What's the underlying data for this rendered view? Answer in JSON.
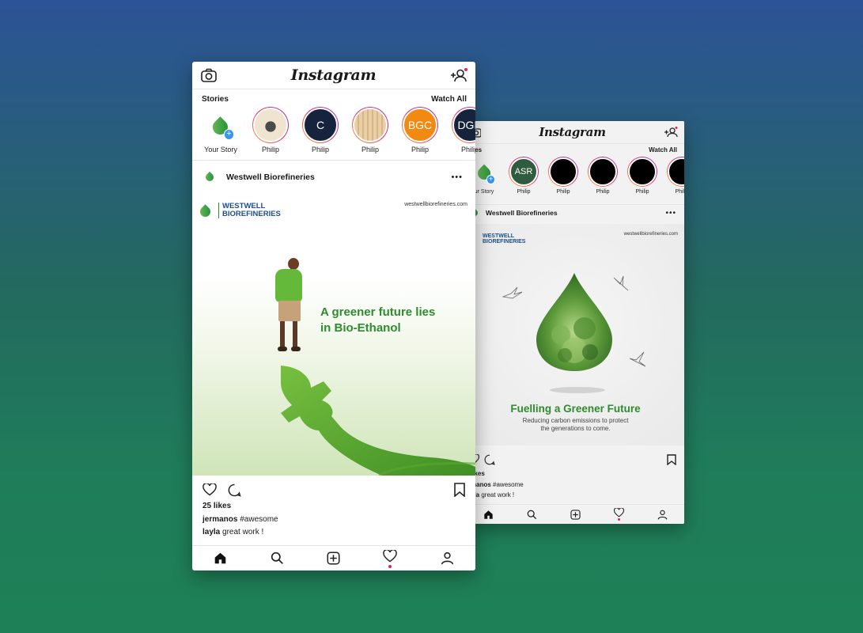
{
  "front": {
    "app_title": "Instagram",
    "stories_label": "Stories",
    "watch_all": "Watch All",
    "stories": [
      {
        "name": "Your Story",
        "type": "own"
      },
      {
        "name": "Philip",
        "type": "photo",
        "initials": ""
      },
      {
        "name": "Philip",
        "type": "initials",
        "initials": "C",
        "color": "#15233d"
      },
      {
        "name": "Philip",
        "type": "photo2",
        "initials": ""
      },
      {
        "name": "Philip",
        "type": "initials",
        "initials": "BGC",
        "color": "#f28a12"
      },
      {
        "name": "Philip",
        "type": "initials",
        "initials": "DGH",
        "color": "#15233d"
      }
    ],
    "post": {
      "account": "Westwell Biorefineries",
      "brand_line1": "WESTWELL",
      "brand_line2": "BIOREFINERIES",
      "website": "westwellbiorefineries.com",
      "headline_line1": "A greener future lies",
      "headline_line2": "in Bio-Ethanol",
      "likes": "25 likes",
      "comments": [
        {
          "user": "jermanos",
          "text": "#awesome"
        },
        {
          "user": "layla",
          "text": "great work !"
        }
      ]
    }
  },
  "back": {
    "app_title": "Instagram",
    "stories_label": "ories",
    "watch_all": "Watch All",
    "stories": [
      {
        "name": "ur Story",
        "type": "own"
      },
      {
        "name": "Philip",
        "type": "initials",
        "initials": "ASR",
        "color": "#2f5b3f"
      },
      {
        "name": "Philip",
        "type": "initials",
        "initials": "",
        "color": "#000000"
      },
      {
        "name": "Philip",
        "type": "initials",
        "initials": "",
        "color": "#000000"
      },
      {
        "name": "Philip",
        "type": "initials",
        "initials": "",
        "color": "#000000"
      },
      {
        "name": "Philip",
        "type": "initials",
        "initials": "",
        "color": "#000000"
      }
    ],
    "post": {
      "account": "Westwell Biorefineries",
      "brand_line1": "WESTWELL",
      "brand_line2": "BIOREFINERIES",
      "website": "westwellbiorefineries.com",
      "headline": "Fuelling a Greener Future",
      "subtext_line1": "Reducing carbon emissions to protect",
      "subtext_line2": "the generations to come.",
      "likes": "likes",
      "comments": [
        {
          "user": "manos",
          "text": "#awesome"
        },
        {
          "user": "yla",
          "text": "great work !"
        }
      ]
    }
  },
  "colors": {
    "brand_green": "#2e8b2f",
    "brand_blue": "#1d4e8f",
    "notif_red": "#e0245e"
  }
}
